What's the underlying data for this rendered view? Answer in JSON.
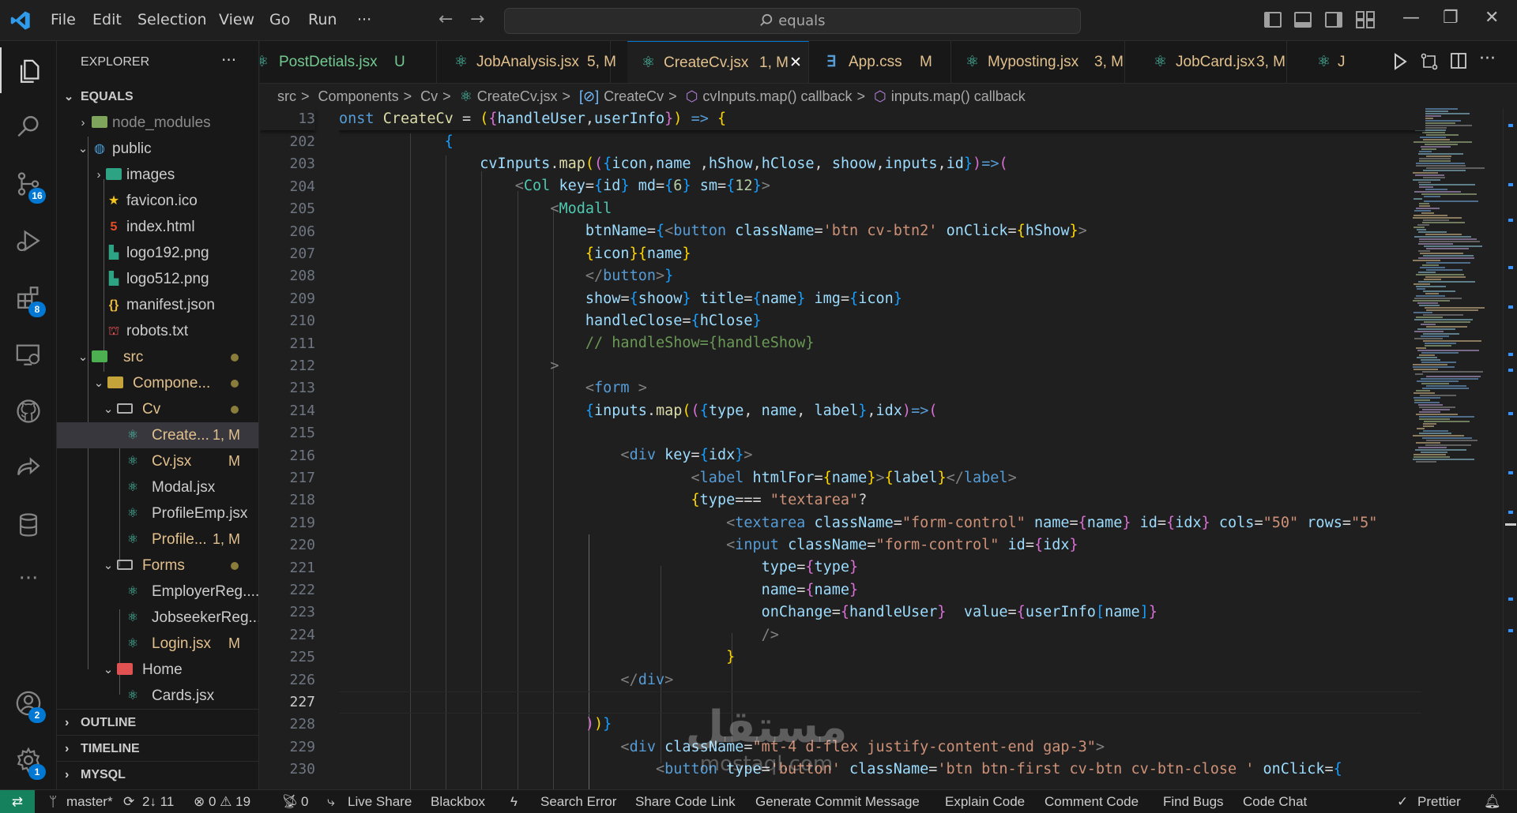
{
  "titlebar": {
    "menus": [
      "File",
      "Edit",
      "Selection",
      "View",
      "Go",
      "Run"
    ],
    "more": "···",
    "back": "←",
    "forward": "→",
    "search_text": "equals",
    "minimize": "—",
    "restore": "❐",
    "close": "✕"
  },
  "activitybar": {
    "scm_badge": "16",
    "extensions_badge": "8",
    "accounts_badge": "2",
    "settings_badge": "1",
    "more": "···"
  },
  "sidebar": {
    "title": "EXPLORER",
    "more": "···",
    "root": "EQUALS",
    "items": [
      {
        "label": "node_modules",
        "decoration": ""
      },
      {
        "label": "public",
        "decoration": ""
      },
      {
        "label": "images",
        "decoration": ""
      },
      {
        "label": "favicon.ico",
        "decoration": ""
      },
      {
        "label": "index.html",
        "decoration": ""
      },
      {
        "label": "logo192.png",
        "decoration": ""
      },
      {
        "label": "logo512.png",
        "decoration": ""
      },
      {
        "label": "manifest.json",
        "decoration": ""
      },
      {
        "label": "robots.txt",
        "decoration": ""
      },
      {
        "label": "src",
        "decoration": ""
      },
      {
        "label": "Compone...",
        "decoration": ""
      },
      {
        "label": "Cv",
        "decoration": ""
      },
      {
        "label": "Create...",
        "decoration": "1, M"
      },
      {
        "label": "Cv.jsx",
        "decoration": "M"
      },
      {
        "label": "Modal.jsx",
        "decoration": ""
      },
      {
        "label": "ProfileEmp.jsx",
        "decoration": ""
      },
      {
        "label": "Profile...",
        "decoration": "1, M"
      },
      {
        "label": "Forms",
        "decoration": ""
      },
      {
        "label": "EmployerReg....",
        "decoration": ""
      },
      {
        "label": "JobseekerReg...",
        "decoration": ""
      },
      {
        "label": "Login.jsx",
        "decoration": "M"
      },
      {
        "label": "Home",
        "decoration": ""
      },
      {
        "label": "Cards.jsx",
        "decoration": ""
      }
    ],
    "sections": [
      "OUTLINE",
      "TIMELINE",
      "MYSQL"
    ]
  },
  "tabs": [
    {
      "label": "PostDetials.jsx",
      "status": "U",
      "active": false
    },
    {
      "label": "JobAnalysis.jsx",
      "status": "5, M",
      "active": false
    },
    {
      "label": "CreateCv.jsx",
      "status": "1, M",
      "active": true
    },
    {
      "label": "App.css",
      "status": "M",
      "active": false
    },
    {
      "label": "Myposting.jsx",
      "status": "3, M",
      "active": false
    },
    {
      "label": "JobCard.jsx",
      "status": "3, M",
      "active": false
    },
    {
      "label": "J",
      "status": "",
      "active": false
    }
  ],
  "tab_close": "✕",
  "breadcrumb": [
    "src",
    "Components",
    "Cv",
    "CreateCv.jsx",
    "CreateCv",
    "cvInputs.map() callback",
    "inputs.map() callback"
  ],
  "breadcrumb_sep": ">",
  "editor": {
    "sticky_line_number": "13",
    "line_numbers": [
      "202",
      "203",
      "204",
      "205",
      "206",
      "207",
      "208",
      "209",
      "210",
      "211",
      "212",
      "213",
      "214",
      "215",
      "216",
      "217",
      "218",
      "219",
      "220",
      "221",
      "222",
      "223",
      "224",
      "225",
      "226",
      "227",
      "228",
      "229",
      "230"
    ],
    "current_line": "227"
  },
  "watermark": {
    "arabic": "مستقل",
    "latin": "mostaql.com"
  },
  "statusbar": {
    "remote": "⇄",
    "branch": "master*",
    "sync": "2↓ 11",
    "problems": "⊗ 0 ⚠ 19",
    "ports": "0",
    "items": [
      "Live Share",
      "Blackbox",
      "Search Error",
      "Share Code Link",
      "Generate Commit Message",
      "Explain Code",
      "Comment Code",
      "Find Bugs",
      "Code Chat"
    ],
    "prettier": "Prettier"
  },
  "colors": {
    "accent": "#0078d4",
    "remote": "#16825d",
    "modified": "#e2c08d",
    "react": "#4ec9b0"
  }
}
